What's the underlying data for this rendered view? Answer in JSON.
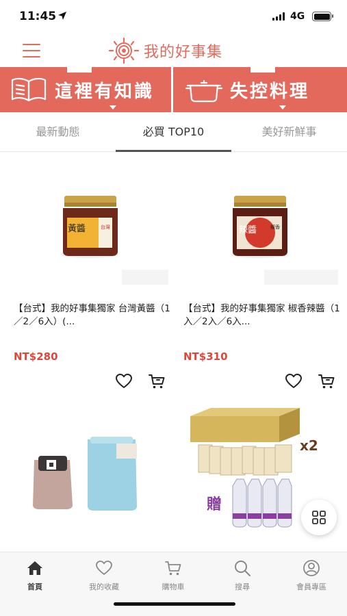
{
  "status_bar": {
    "time": "11:45",
    "network": "4G"
  },
  "header": {
    "logo_text": "我的好事集",
    "brand_color": "#e36b5c"
  },
  "banner": {
    "left_label": "這裡有知識",
    "right_label": "失控料理",
    "background": "#e4695d"
  },
  "tabs": [
    {
      "label": "最新動態",
      "active": false
    },
    {
      "label": "必買 TOP10",
      "active": true
    },
    {
      "label": "美好新鮮事",
      "active": false
    }
  ],
  "products": [
    {
      "title": "【台式】我的好事集獨家 台灣黃醬（1／2／6入）(...",
      "price": "NT$280",
      "jar_label": "黃醬",
      "jar_sub": "台灣"
    },
    {
      "title": "【台式】我的好事集獨家 椒香辣醬（1入／2入／6入...",
      "price": "NT$310",
      "jar_label": "辣醬",
      "jar_sub": "椒香"
    },
    {
      "title": "",
      "price": ""
    },
    {
      "title": "",
      "price": "",
      "gift_text": "贈",
      "qty_text": "x2"
    }
  ],
  "bottom_nav": [
    {
      "label": "首頁",
      "icon": "home-icon",
      "active": true
    },
    {
      "label": "我的收藏",
      "icon": "heart-icon",
      "active": false
    },
    {
      "label": "購物車",
      "icon": "cart-icon",
      "active": false
    },
    {
      "label": "搜尋",
      "icon": "search-icon",
      "active": false
    },
    {
      "label": "會員專區",
      "icon": "user-icon",
      "active": false
    }
  ],
  "colors": {
    "price": "#e0453a",
    "accent": "#e4695d"
  }
}
